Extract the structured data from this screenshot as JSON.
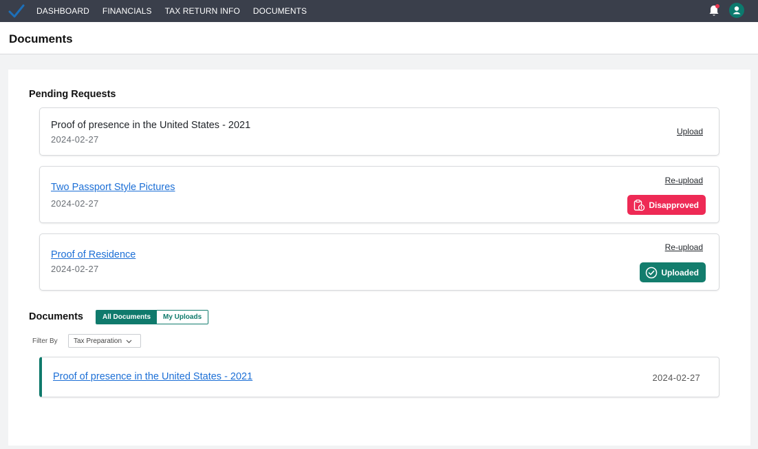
{
  "nav": {
    "links": [
      "DASHBOARD",
      "FINANCIALS",
      "TAX RETURN INFO",
      "DOCUMENTS"
    ]
  },
  "page": {
    "title": "Documents"
  },
  "pending": {
    "title": "Pending Requests",
    "items": [
      {
        "title": "Proof of presence in the United States - 2021",
        "date": "2024-02-27",
        "action": "Upload"
      },
      {
        "title": "Two Passport Style Pictures",
        "date": "2024-02-27",
        "action": "Re-upload",
        "status": "Disapproved"
      },
      {
        "title": "Proof of Residence",
        "date": "2024-02-27",
        "action": "Re-upload",
        "status": "Uploaded"
      }
    ]
  },
  "documents": {
    "title": "Documents",
    "tabs": [
      "All Documents",
      "My Uploads"
    ],
    "filter_label": "Filter By",
    "filter_value": "Tax Preparation",
    "rows": [
      {
        "title": "Proof of presence in the United States - 2021",
        "date": "2024-02-27"
      }
    ]
  },
  "colors": {
    "nav_bg": "#3a3f4b",
    "accent": "#0f7a6c",
    "link": "#1c6fd6",
    "disapproved": "#ee2a55",
    "uploaded": "#137d6d"
  }
}
